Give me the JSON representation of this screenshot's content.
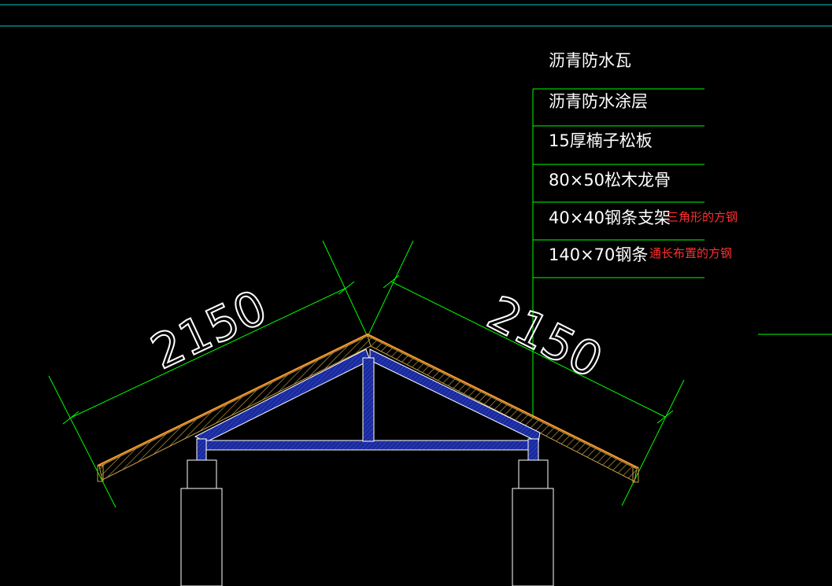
{
  "colors": {
    "background": "#000000",
    "leader_line": "#00ff00",
    "dimension_line": "#00ff00",
    "frame_line": "#00c8c8",
    "steel": "#1a2a9c",
    "steel_outline": "#ffffff",
    "roof_board": "#c8a040",
    "roof_surface": "#ff9a30",
    "column": "#ffffff",
    "label_text": "#ffffff",
    "note_text": "#ff3030"
  },
  "layers": [
    {
      "label": "沥青防水瓦",
      "note": ""
    },
    {
      "label": "沥青防水涂层",
      "note": ""
    },
    {
      "label": "15厚楠子松板",
      "note": ""
    },
    {
      "label": "80×50松木龙骨",
      "note": ""
    },
    {
      "label": "40×40钢条支架",
      "note": "三角形的方钢"
    },
    {
      "label": "140×70钢条",
      "note": "通长布置的方钢"
    }
  ],
  "dimensions": {
    "left_slope": "2150",
    "right_slope": "2150"
  }
}
